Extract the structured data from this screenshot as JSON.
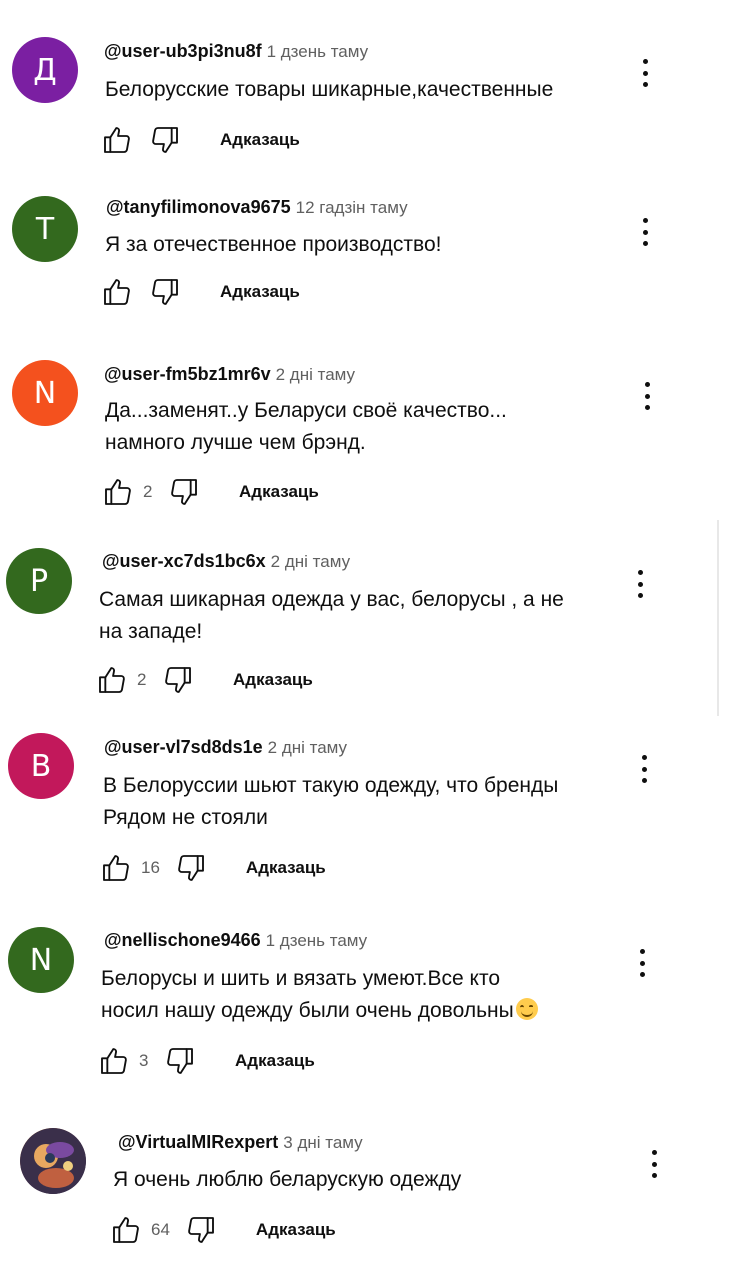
{
  "reply_label": "Адказаць",
  "comments": [
    {
      "avatar_letter": "Д",
      "avatar_color": "#7b1fa2",
      "handle": "@user-ub3pi3nu8f",
      "time": "1 дзень таму",
      "lines": [
        "Белорусские товары шикарные,качественные"
      ],
      "likes": ""
    },
    {
      "avatar_letter": "T",
      "avatar_color": "#33691e",
      "handle": "@tanyfilimonova9675",
      "time": "12 гадзін таму",
      "lines": [
        "Я за отечественное производство!"
      ],
      "likes": ""
    },
    {
      "avatar_letter": "N",
      "avatar_color": "#f4511e",
      "handle": "@user-fm5bz1mr6v",
      "time": "2 дні таму",
      "lines": [
        "Да...заменят..у Беларуси своё качество...",
        "намного лучше чем брэнд."
      ],
      "likes": "2"
    },
    {
      "avatar_letter": "P",
      "avatar_color": "#33691e",
      "handle": "@user-xc7ds1bc6x",
      "time": "2 дні таму",
      "lines": [
        "Самая шикарная одежда у вас, белорусы , а не",
        "на западе!"
      ],
      "likes": "2"
    },
    {
      "avatar_letter": "B",
      "avatar_color": "#c2185b",
      "handle": "@user-vl7sd8ds1e",
      "time": "2 дні таму",
      "lines": [
        "В Белоруссии шьют такую одежду, что бренды",
        "Рядом не стояли"
      ],
      "likes": "16"
    },
    {
      "avatar_letter": "N",
      "avatar_color": "#33691e",
      "handle": "@nellischone9466",
      "time": "1 дзень таму",
      "lines": [
        "Белорусы и шить и вязать умеют.Все кто",
        "носил нашу одежду были очень довольны"
      ],
      "likes": "3",
      "emoji": "smiling-face-emoji"
    },
    {
      "avatar_letter": "",
      "avatar_color": "#6a3a5a",
      "handle": "@VirtualMIRexpert",
      "time": "3 дні таму",
      "lines": [
        "Я очень люблю беларускую одежду"
      ],
      "likes": "64"
    }
  ],
  "icons": {
    "like": "thumbs-up-icon",
    "dislike": "thumbs-down-icon",
    "menu": "more-vertical-icon"
  }
}
